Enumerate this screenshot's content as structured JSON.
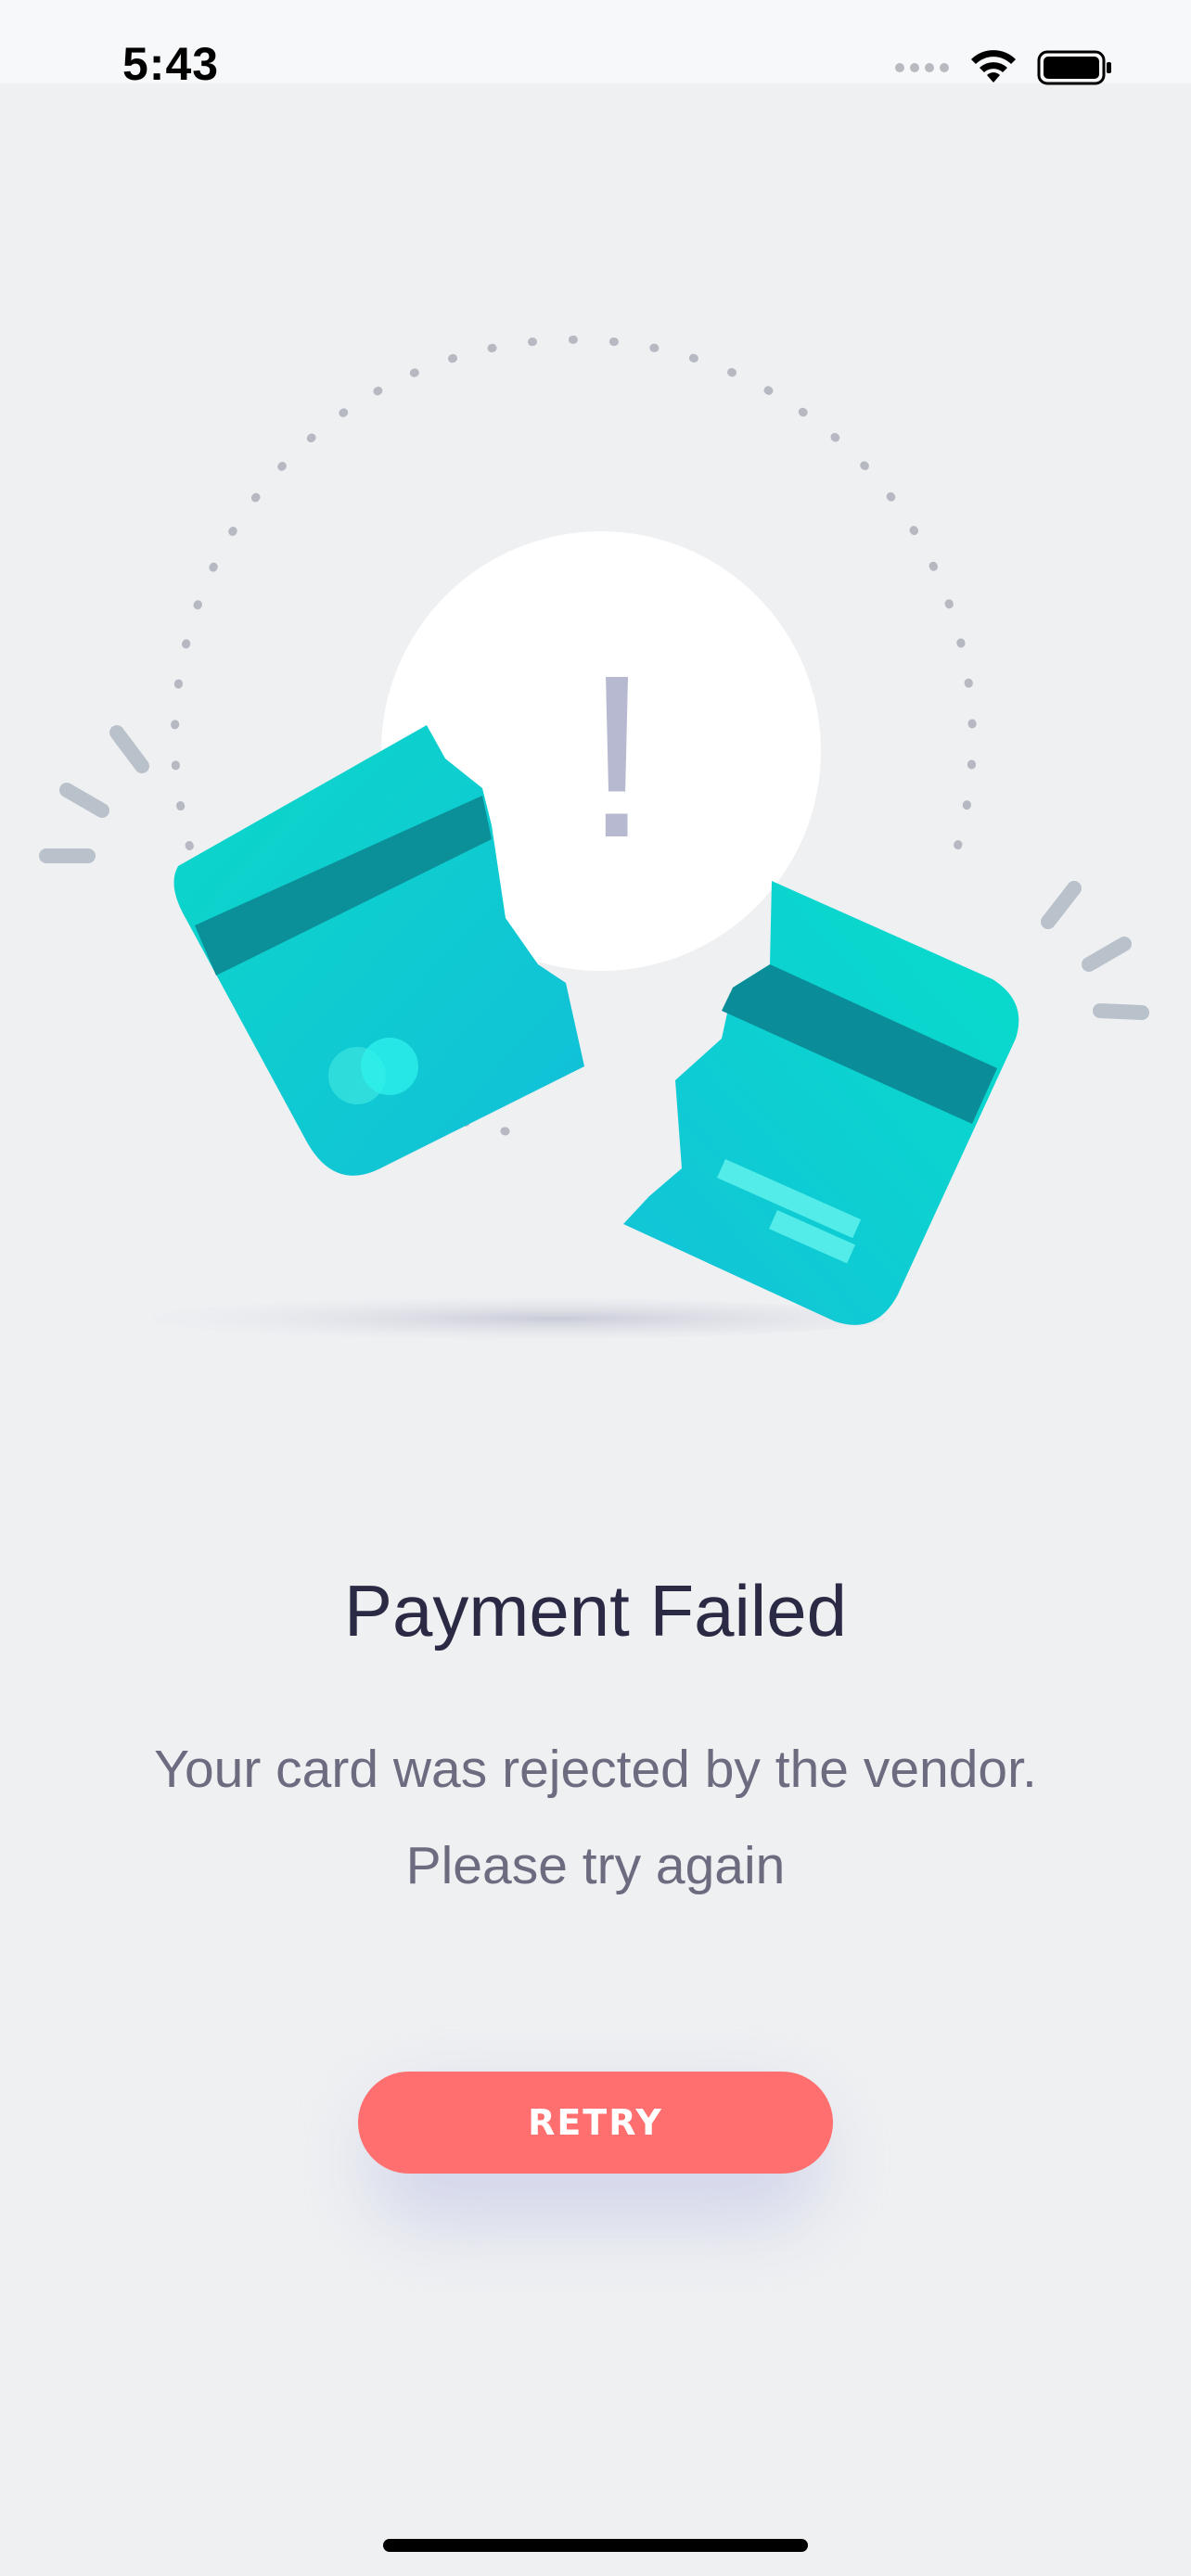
{
  "status_bar": {
    "time": "5:43",
    "signal_icon": "signal-dots-icon",
    "wifi_icon": "wifi-icon",
    "battery_icon": "battery-icon"
  },
  "illustration": {
    "alert_symbol": "!",
    "card_color": "#13c9d2",
    "stripe_color": "#0a8f97",
    "accent_color": "#54f1ee"
  },
  "content": {
    "title": "Payment Failed",
    "message_line1": "Your card was rejected by the vendor.",
    "message_line2": "Please try again"
  },
  "actions": {
    "retry_label": "RETRY",
    "retry_color": "#ff6f6f"
  }
}
